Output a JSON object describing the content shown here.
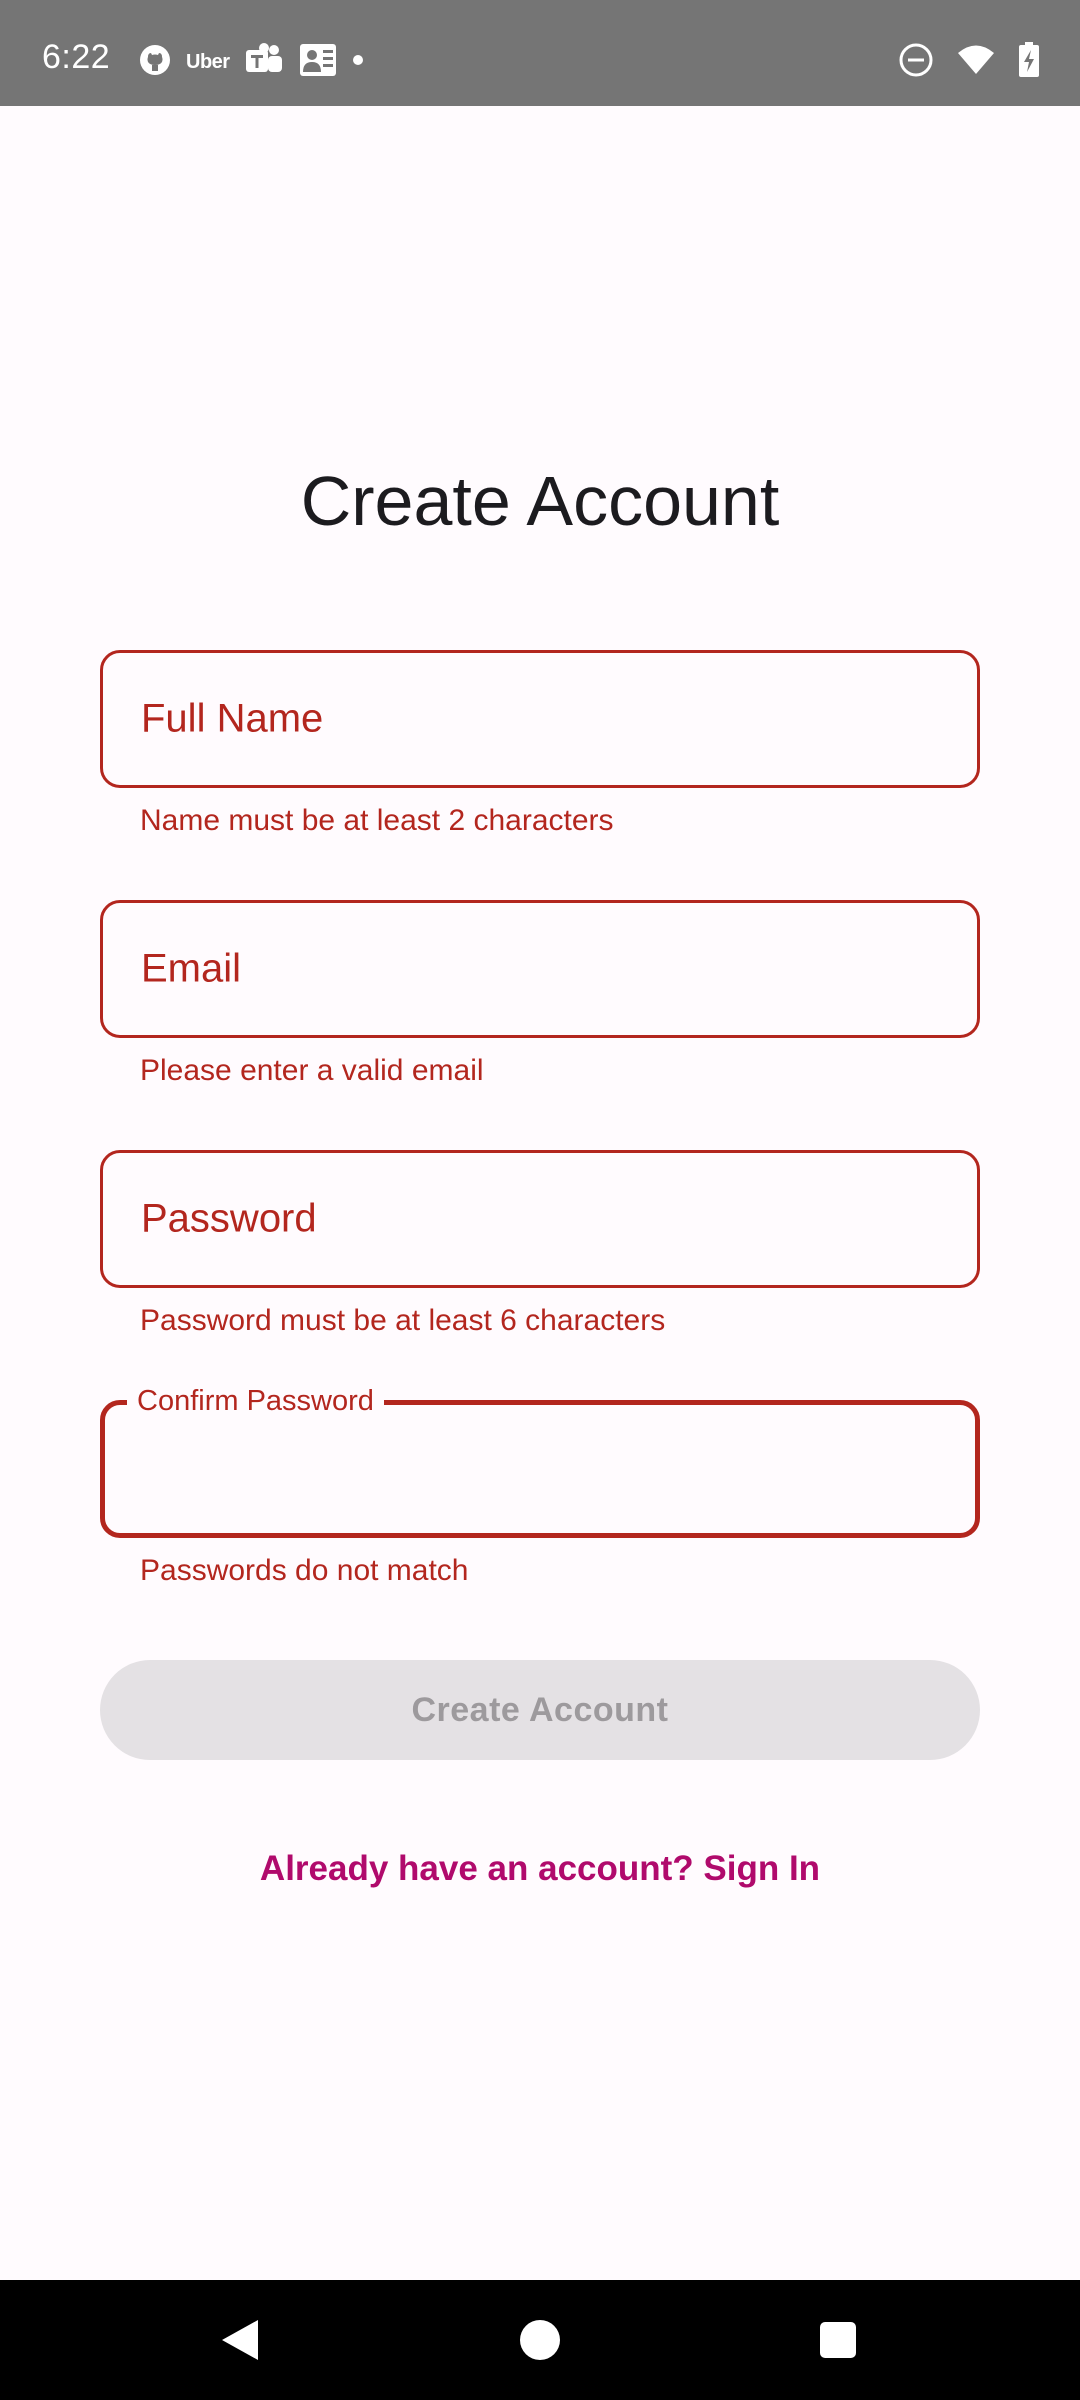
{
  "status_bar": {
    "time": "6:22",
    "left_icons": [
      "github-icon",
      "uber-icon",
      "teams-icon",
      "work-profile-icon",
      "dot-icon"
    ],
    "uber_text": "Uber",
    "right_icons": [
      "do-not-disturb-icon",
      "wifi-icon",
      "battery-charging-icon"
    ]
  },
  "page": {
    "title": "Create Account"
  },
  "form": {
    "full_name": {
      "placeholder": "Full Name",
      "error": "Name must be at least 2 characters"
    },
    "email": {
      "placeholder": "Email",
      "error": "Please enter a valid email"
    },
    "password": {
      "placeholder": "Password",
      "error": "Password must be at least 6 characters"
    },
    "confirm_password": {
      "label": "Confirm Password",
      "value": "",
      "error": "Passwords do not match"
    },
    "submit_label": "Create Account",
    "submit_enabled": false
  },
  "links": {
    "sign_in": "Already have an account? Sign In"
  },
  "colors": {
    "error": "#B3261E",
    "background": "#FFFBFE",
    "link": "#B00A6C",
    "disabled_button_bg": "#E4E1E4",
    "disabled_button_text": "#9D9A9D",
    "status_bar": "#757575",
    "nav_bar": "#000000"
  },
  "nav_bar": {
    "icons": [
      "back-icon",
      "home-icon",
      "recents-icon"
    ]
  }
}
